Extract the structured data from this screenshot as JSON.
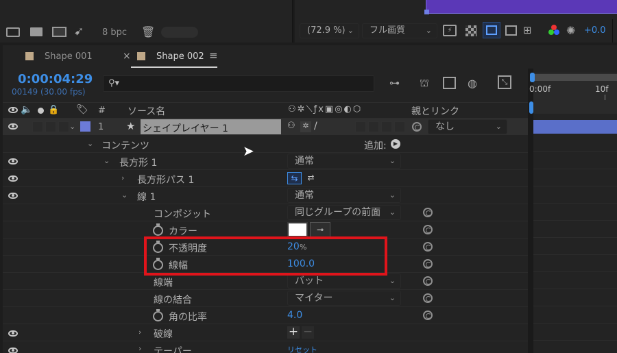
{
  "top_toolbar": {
    "bpc_label": "8 bpc",
    "zoom_value": "(72.9 %)",
    "resolution_value": "フル画質",
    "exposure_value": "+0.0"
  },
  "tabs": [
    {
      "label": "Shape 001",
      "active": false
    },
    {
      "label": "Shape 002",
      "active": true
    }
  ],
  "timecode": {
    "time": "0:00:04:29",
    "frames": "00149 (30.00 fps)"
  },
  "search": {
    "placeholder": ""
  },
  "timeline": {
    "ruler_start": "0:00f",
    "ruler_mark": "10f"
  },
  "columns": {
    "number": "#",
    "source_name": "ソース名",
    "parent_link": "親とリンク"
  },
  "layer": {
    "number": "1",
    "name": "シェイプレイヤー 1",
    "parent_value": "なし",
    "label_color": "#6c7bd8"
  },
  "properties": {
    "contents": "コンテンツ",
    "add_label": "追加:",
    "rect1": "長方形 1",
    "rect1_mode": "通常",
    "rect_path": "長方形パス 1",
    "stroke1": "線 1",
    "stroke1_mode": "通常",
    "composite": "コンポジット",
    "composite_value": "同じグループの前面",
    "color": "カラー",
    "opacity": "不透明度",
    "opacity_value": "20",
    "opacity_unit": "%",
    "stroke_width": "線幅",
    "stroke_width_value": "100.0",
    "line_cap": "線端",
    "line_cap_value": "バット",
    "line_join": "線の結合",
    "line_join_value": "マイター",
    "miter_limit": "角の比率",
    "miter_limit_value": "4.0",
    "dashes": "破線",
    "taper": "テーパー",
    "taper_value": "リセット"
  },
  "colors": {
    "accent_blue": "#3d8ee6",
    "highlight_red": "#e0141b",
    "timeline_bar": "#5a6fc9",
    "viewer_purple": "#5b38b7"
  }
}
